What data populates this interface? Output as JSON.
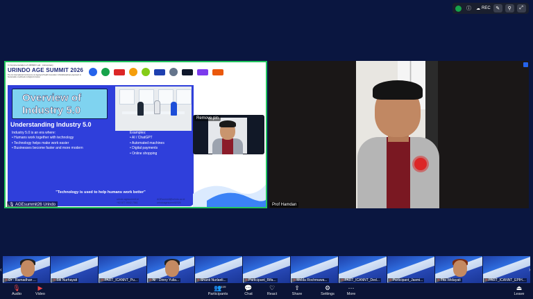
{
  "top_bar": {
    "rec_label": "REC",
    "status_color": "#16a34a"
  },
  "slide": {
    "commemoration": "In Commemoration of URINDO Lab · Anniversary",
    "title": "URINDO AGE SUMMIT 2026",
    "subtitle": "The 1st International Conference on Ageing & Health Innovation: A Multidisciplinary Approach to Sustainable Livelihoods & Digital Inclusion",
    "overview_title": "Overview of Industry 5.0",
    "section_title": "Understanding Industry 5.0",
    "intro": "Industry 5.0 is an era where:",
    "points": [
      "• Humans work together with technology",
      "• Technology helps make work easier",
      "• Businesses become faster and more modern"
    ],
    "examples_label": "Examples:",
    "examples": [
      "• AI / ChatGPT",
      "• Automated machines",
      "• Digital payments",
      "• Online shopping"
    ],
    "quote": "\"Technology is used to help humans work better\"",
    "contacts_left": [
      "urindo.agesummit.id",
      "+62 877-9042-7561"
    ],
    "contacts_right": [
      "AGEsummit@urindo.ac.id",
      "urindoagesummit2026"
    ],
    "caption": "AGEsummit26 Urindo"
  },
  "pin_tile": {
    "label": "Remove pin"
  },
  "speaker": {
    "name": "Prof Hamdan"
  },
  "gallery": [
    {
      "name": "Dr - Ramadhan ..."
    },
    {
      "name": "Siti Nurhayati"
    },
    {
      "name": "PART_ICANNT_Pu..."
    },
    {
      "name": "Ni - Dinny Yulia..."
    },
    {
      "name": "Shanti Nurlaeli..."
    },
    {
      "name": "Participant_Rifa..."
    },
    {
      "name": "Melda Rochmawa..."
    },
    {
      "name": "PART_ICANNT_Ded..."
    },
    {
      "name": "Participant_Jasmi..."
    },
    {
      "name": "Tita Widayati"
    },
    {
      "name": "PART_ICANNT_EPIH..."
    }
  ],
  "toolbar": {
    "audio": "Audio",
    "video": "Video",
    "participants": "Participants",
    "participants_count": "229",
    "chat": "Chat",
    "react": "React",
    "share": "Share",
    "settings": "Settings",
    "more": "More",
    "leave": "Leave"
  }
}
